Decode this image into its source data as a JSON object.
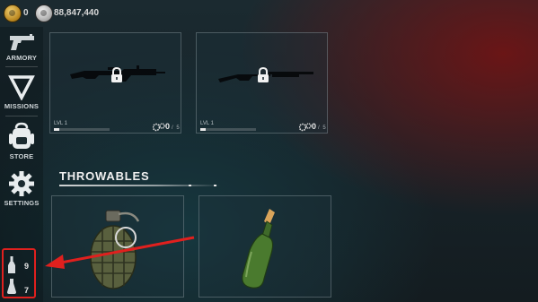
{
  "currency": {
    "gold_value": "0",
    "silver_value": "88,847,440"
  },
  "sidebar": {
    "items": [
      {
        "label": "ARMORY",
        "icon": "pistol-icon"
      },
      {
        "label": "MISSIONS",
        "icon": "triangle-down-icon"
      },
      {
        "label": "STORE",
        "icon": "backpack-icon"
      },
      {
        "label": "SETTINGS",
        "icon": "gear-icon"
      }
    ]
  },
  "consumables": {
    "bottle_count": "9",
    "flask_count": "7"
  },
  "weapons": [
    {
      "level": "LVL 1",
      "parts": "0",
      "parts_total": "5",
      "locked": true,
      "icon": "rifle-icon",
      "level_progress": 0.1
    },
    {
      "level": "LVL 1",
      "parts": "0",
      "parts_total": "5",
      "locked": true,
      "icon": "shotgun-icon",
      "level_progress": 0.1
    }
  ],
  "throwables": {
    "title": "THROWABLES",
    "items": [
      {
        "icon": "frag-grenade-icon"
      },
      {
        "icon": "molotov-bottle-icon"
      }
    ]
  },
  "colors": {
    "highlight": "#e0201e",
    "accent_red_bg": "#781212"
  }
}
